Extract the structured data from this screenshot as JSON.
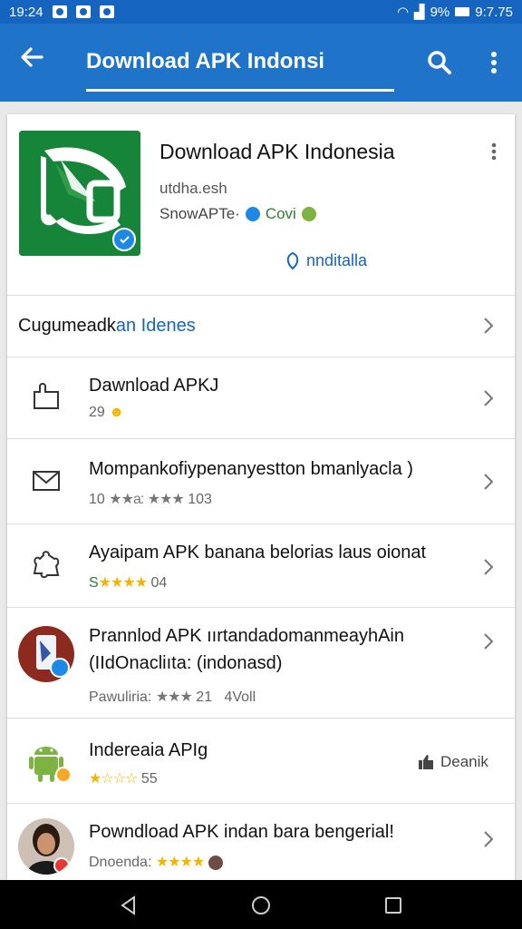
{
  "status": {
    "time": "19:24",
    "battery": "9%",
    "right_time": "9:7.75"
  },
  "appbar": {
    "title": "Download APK Indonsi"
  },
  "hero": {
    "app_name": "Download APK Indonesia",
    "developer": "utdha.esh",
    "meta_text": "SnowAPTe·",
    "meta_badge": "Covi",
    "install_label": "nnditalla"
  },
  "section": {
    "prefix": "Cugumeadk",
    "suffix": "an Idenes"
  },
  "rows": [
    {
      "title": "Dawnload APKJ",
      "sub": "29",
      "icon": "bag-icon"
    },
    {
      "title": "Mompankofiypenanyestton bmanlyacla )",
      "sub_prefix": "10",
      "stars_a": "★★a:",
      "stars_b": "★★★",
      "sub_num": "103",
      "icon": "mail-icon"
    },
    {
      "title": "Ayaipam APK banana belorias laus oionat",
      "sub_prefix": "S",
      "stars": "★★★★",
      "sub_num": "04",
      "icon": "puzzle-icon"
    },
    {
      "title": "Prannlod APK ıırtandadomanmeayhAin",
      "title2": "(IIdOnacliıta: (indonasd)",
      "sub_prefix": "Pawuliria:",
      "stars": "★★★",
      "sub_num": "21",
      "sub_num2": "4Voll",
      "icon": "phone-app-icon"
    },
    {
      "title": "Indereaia  APIg",
      "stars": "★☆☆☆",
      "sub_num": "55",
      "side_label": "Deanik",
      "icon": "android-icon"
    },
    {
      "title": "Powndload APK indan bara bengerial!",
      "sub_prefix": "Dnoenda:",
      "stars": "★★★★",
      "icon": "avatar"
    }
  ],
  "colors": {
    "primary": "#1f73c9",
    "status": "#1565c0",
    "star": "#f4b400",
    "logo_green": "#16853a"
  }
}
